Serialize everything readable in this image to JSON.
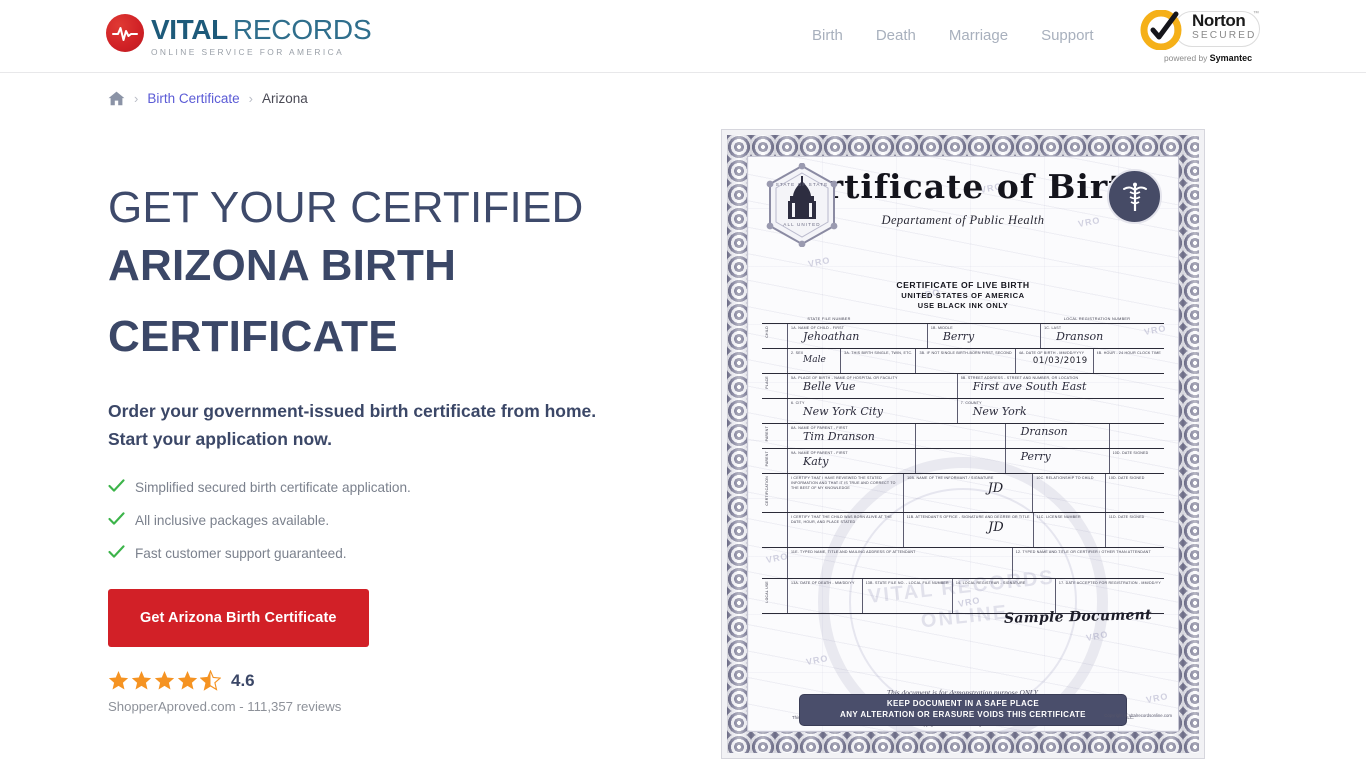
{
  "header": {
    "logo": {
      "icon": "heartbeat-pulse-icon",
      "word1": "VITAL",
      "word2": "RECORDS",
      "tagline": "ONLINE SERVICE FOR AMERICA"
    },
    "nav": [
      {
        "label": "Birth"
      },
      {
        "label": "Death"
      },
      {
        "label": "Marriage"
      },
      {
        "label": "Support"
      }
    ],
    "norton": {
      "name": "Norton",
      "secured": "SECURED",
      "tm": "™",
      "powered_prefix": "powered by ",
      "powered_brand": "Symantec"
    }
  },
  "breadcrumb": {
    "home_icon": "home-icon",
    "sep": "›",
    "items": [
      {
        "label": "Birth Certificate"
      },
      {
        "label": "Arizona"
      }
    ]
  },
  "hero": {
    "headline_light": "GET YOUR CERTIFIED",
    "headline_bold": "ARIZONA BIRTH CERTIFICATE",
    "subheading": "Order your government-issued birth certificate from home. Start your application now.",
    "bullets": [
      {
        "text": "Simplified secured birth certificate application."
      },
      {
        "text": "All inclusive packages available."
      },
      {
        "text": "Fast customer support guaranteed."
      }
    ],
    "cta_label": "Get Arizona Birth Certificate",
    "rating": {
      "score": "4.6",
      "stars_full": 4,
      "stars_half": 1,
      "source": "ShopperAproved.com - 111,357 reviews"
    }
  },
  "certificate": {
    "title": "Certificate of Birth",
    "subtitle": "Departament of Public Health",
    "state_seal": {
      "top_text": "STATE OF STATE",
      "bottom_text": "ALL UNITED"
    },
    "caduceus_icon": "caduceus-icon",
    "live_birth_line1": "CERTIFICATE OF LIVE BIRTH",
    "live_birth_line2": "UNITED STATES OF AMERICA",
    "live_birth_line3": "USE BLACK INK ONLY",
    "col_headers": [
      "STATE FILE NUMBER",
      "LOCAL REGISTRATION NUMBER"
    ],
    "fields": {
      "child_first_label": "1a. NAME OF CHILD - FIRST",
      "child_first": "Jehoathan",
      "child_middle_label": "1b. MIDDLE",
      "child_middle": "Berry",
      "child_last_label": "1c. LAST",
      "child_last": "Dranson",
      "sex_label": "2. SEX",
      "sex": "Male",
      "plural_label": "3a. THIS BIRTH SINGLE, TWIN, ETC.",
      "birth_order_label": "3b. IF NOT SINGLE BIRTH-BORN FIRST, SECOND",
      "dob_label": "4a. DATE OF BIRTH - MM/DD/YYYY",
      "dob": "01/03/2019",
      "hour_label": "4b. HOUR - 24 HOUR CLOCK TIME",
      "place_label": "5a. PLACE OF BIRTH - NAME OF HOSPITAL OR FACILITY",
      "place": "Belle Vue",
      "street_label": "5b. STREET ADDRESS - STREET AND NUMBER, OR LOCATION",
      "street": "First ave South East",
      "city_label": "6. CITY",
      "city": "New York City",
      "county_label": "7. COUNTY",
      "county": "New York",
      "parent1_label": "8a. NAME OF PARENT - FIRST",
      "parent1": "Tim Dranson",
      "parent1_last": "Dranson",
      "parent2_label": "9a. NAME OF PARENT - FIRST",
      "parent2": "Katy",
      "parent2_last": "Perry",
      "cert_stmt1": "I CERTIFY THAT I HAVE REVIEWED THE STATED INFORMATION AND THAT IT IS TRUE AND CORRECT TO THE BEST OF MY KNOWLEDGE",
      "cert_stmt2": "I CERTIFY THAT THE CHILD WAS BORN ALIVE AT THE DATE, HOUR, AND PLACE STATED",
      "informant_label": "10b. NAME OF THE INFORMANT / SIGNATURE",
      "attendant_label": "11b. ATTENDANT'S OFFICE - SIGNATURE AND DEGREE OR TITLE",
      "relation_label": "10c. RELATIONSHIP TO CHILD",
      "date_signed_label": "10d. DATE SIGNED",
      "license_label": "11c. LICENSE NUMBER",
      "date_signed2_label": "11d. DATE SIGNED",
      "attendant_name_label": "11e. TYPED NAME, TITLE AND MAILING ADDRESS OF ATTENDANT",
      "certifier_label": "12. TYPED NAME AND TITLE OR CERTIFIER / OTHER THAN ATTENDANT",
      "sig1": "JD",
      "sig2": "JD",
      "date_death_label": "13a. DATE OF DEATH - MM/DD/YY",
      "file_label": "13b. STATE FILE NO. - LOCAL FILE NUMBER",
      "registrar_label": "14. LOCAL REGISTRAR - SIGNATURE",
      "date_accept_label": "17. DATE ACCEPTED FOR REGISTRATION - MM/DD/YY"
    },
    "watermark_text": "VRO",
    "seal_watermark": "VITAL RECORDS ONLINE",
    "sample_stamp": "Sample Document",
    "disclaimer_line1": "This document is for demonstration purpose ONLY.",
    "disclaimer_line2": "The information contained in this document are not real.",
    "copyright_note": "This photography is property of VRO LLC. It is protected by U.S. Copyright Laws, and is not to be downloaded or reproduced in any way without the written permission of VRO LLC. Copyright 2020 VRO LLC. All Rights Reserved.",
    "banner_line1": "KEEP DOCUMENT IN A SAFE PLACE",
    "banner_line2": "ANY ALTERATION OR ERASURE VOIDS THIS CERTIFICATE",
    "bottom_copyright": "Copyright of Vitalrecordsonline.com"
  },
  "colors": {
    "brand_red": "#d22027",
    "logo_blue": "#1d5a7a",
    "heading_navy": "#3b4767",
    "nav_gray": "#a8b0bd",
    "check_green": "#3cb44a",
    "star_orange": "#f59322",
    "link_purple": "#5b5bd6"
  }
}
